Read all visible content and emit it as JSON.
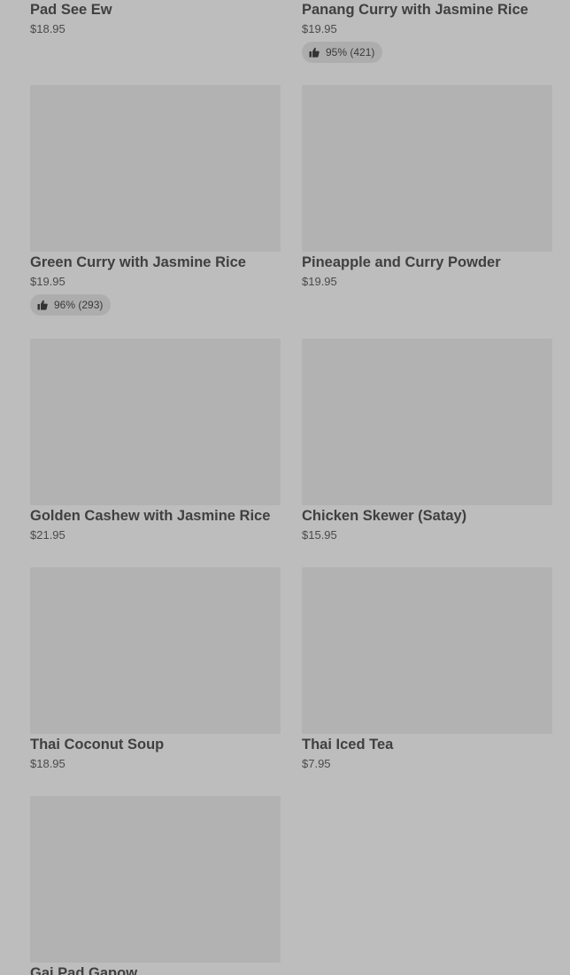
{
  "menu_items": [
    {
      "name": "Pad See Ew",
      "price": "$18.95"
    },
    {
      "name": "Panang Curry with Jasmine Rice",
      "price": "$19.95",
      "rating": "95% (421)"
    },
    {
      "name": "Green Curry with Jasmine Rice",
      "price": "$19.95",
      "rating": "96% (293)"
    },
    {
      "name": "Pineapple and Curry Powder",
      "price": "$19.95"
    },
    {
      "name": "Golden Cashew with Jasmine Rice",
      "price": "$21.95"
    },
    {
      "name": "Chicken Skewer (Satay)",
      "price": "$15.95"
    },
    {
      "name": "Thai Coconut Soup",
      "price": "$18.95"
    },
    {
      "name": "Thai Iced Tea",
      "price": "$7.95"
    },
    {
      "name": "Gai Pad Gapow"
    }
  ],
  "icons": {
    "rating": "thumbs-up-icon"
  }
}
